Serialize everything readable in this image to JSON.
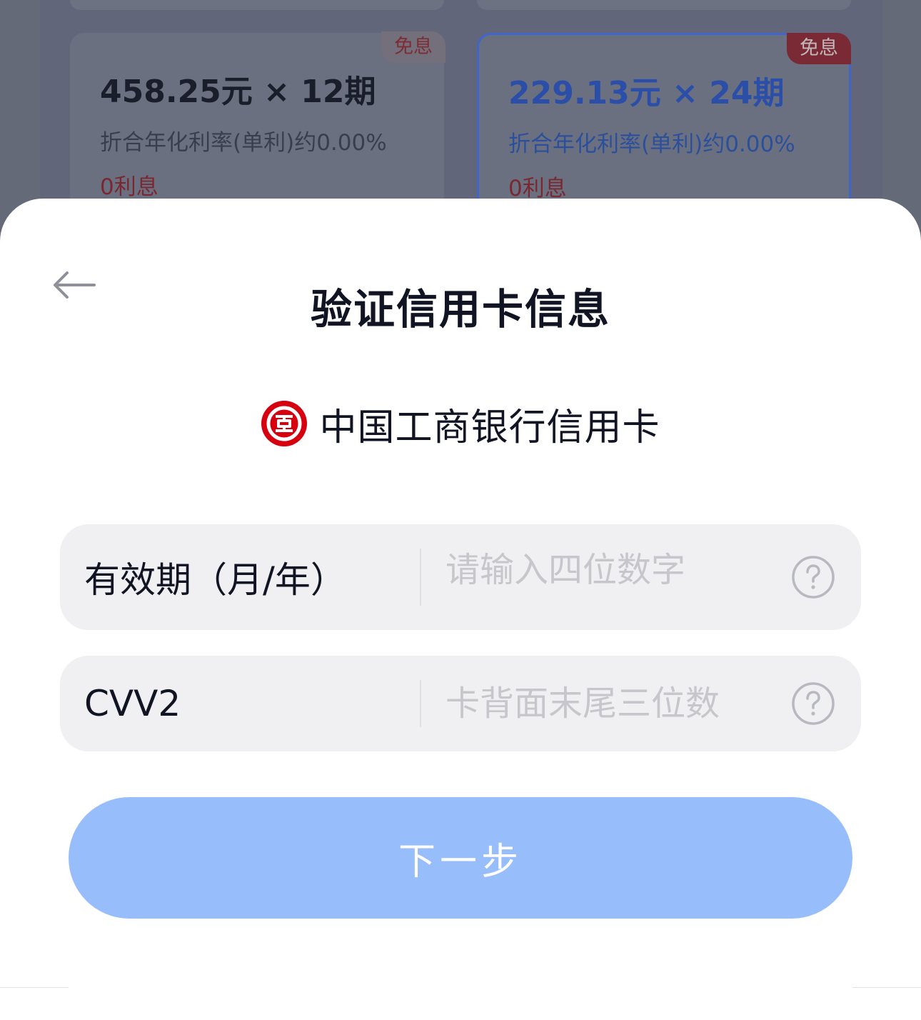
{
  "background": {
    "plans": [
      {
        "badge": "免息",
        "amount": "458.25元 × 12期",
        "rate": "折合年化利率(单利)约0.00%",
        "interest": "0利息",
        "selected": false
      },
      {
        "badge": "免息",
        "amount": "229.13元 × 24期",
        "rate": "折合年化利率(单利)约0.00%",
        "interest": "0利息",
        "selected": true
      }
    ]
  },
  "sheet": {
    "back_icon": "arrow-left-icon",
    "title": "验证信用卡信息",
    "bank": {
      "logo_icon": "icbc-logo-icon",
      "name": "中国工商银行信用卡"
    },
    "fields": {
      "expiry": {
        "label": "有效期（月/年）",
        "placeholder": "请输入四位数字",
        "value": "",
        "help_icon": "question-circle-icon"
      },
      "cvv": {
        "label": "CVV2",
        "placeholder": "卡背面末尾三位数",
        "value": "",
        "help_icon": "question-circle-icon"
      }
    },
    "next_button": "下一步"
  },
  "colors": {
    "primary_disabled": "#98bdfb",
    "selected_border": "#3f66c8",
    "badge_red": "#7a2a35",
    "icbc_red": "#d7000f"
  }
}
